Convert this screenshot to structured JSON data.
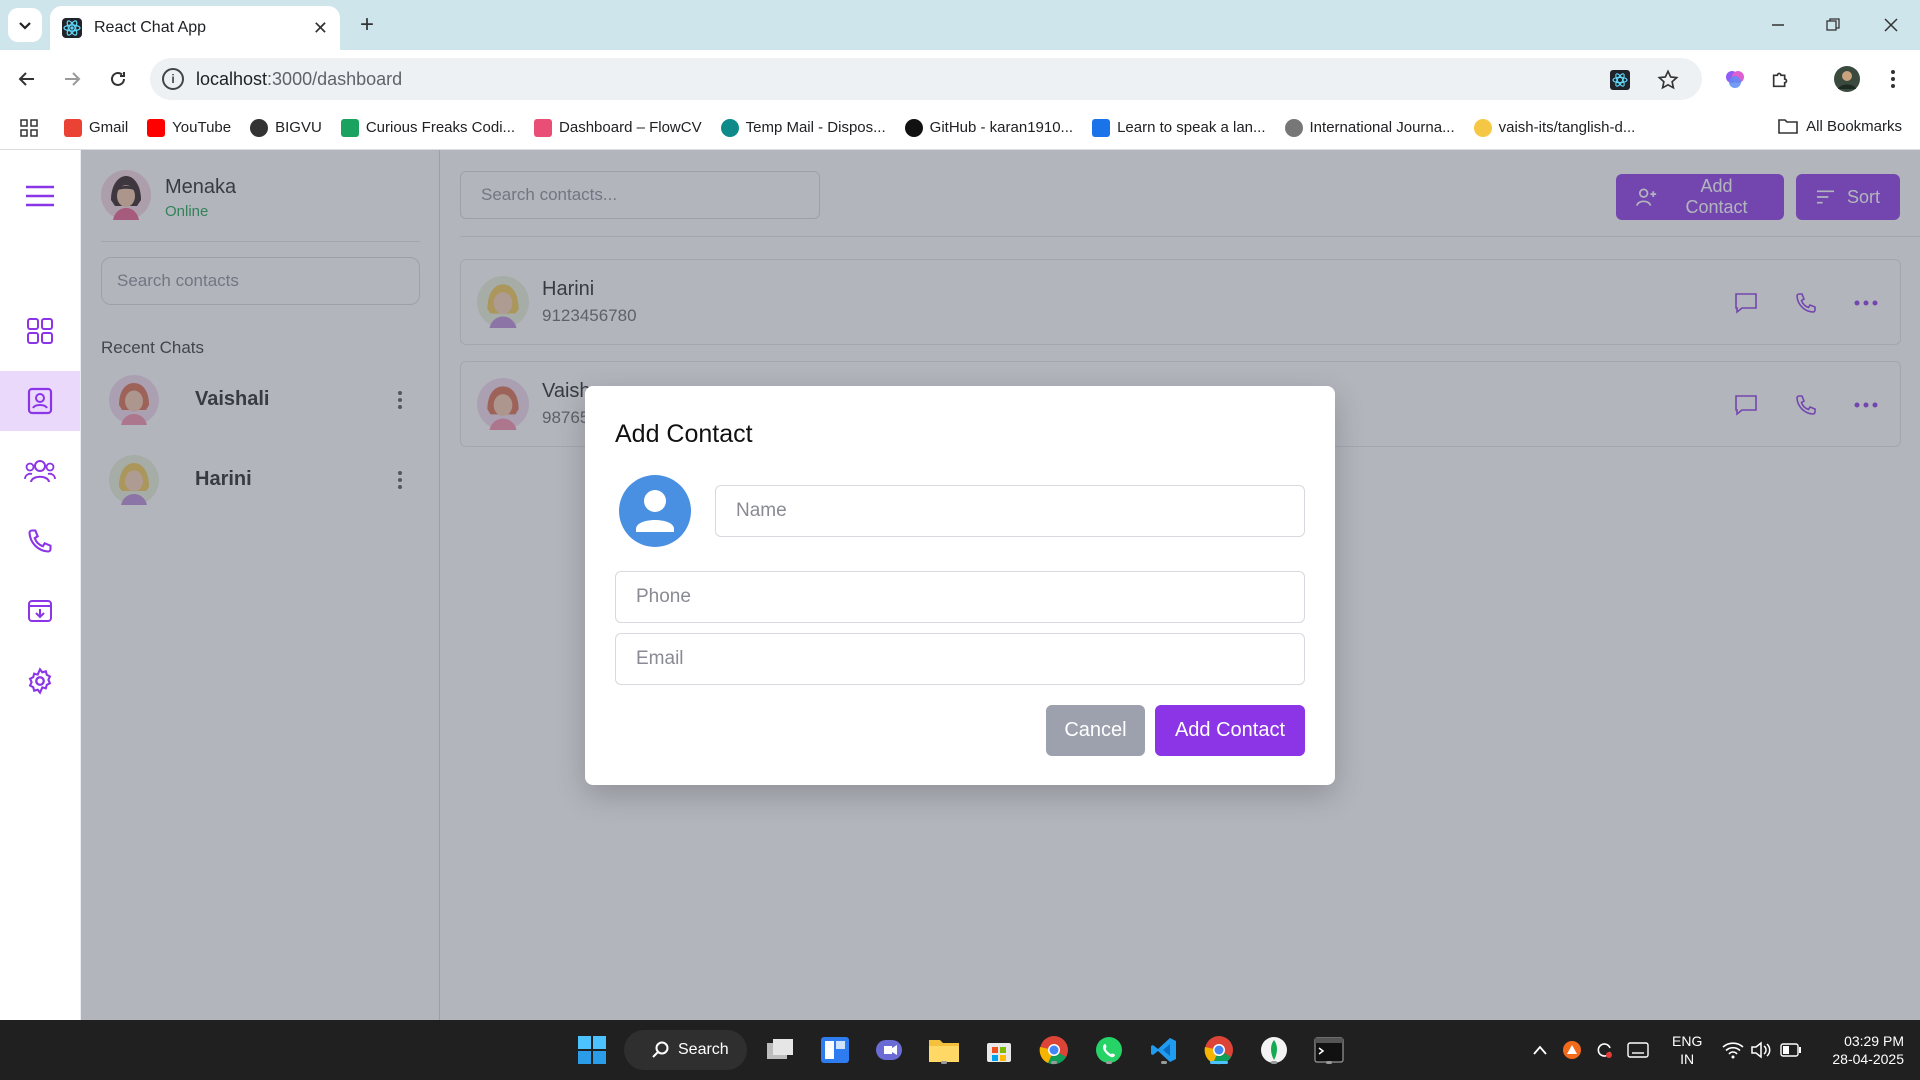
{
  "browser": {
    "tab_title": "React Chat App",
    "url_host": "localhost",
    "url_path": ":3000/dashboard"
  },
  "bookmarks": [
    {
      "label": "Gmail",
      "icon": "gmail-icon",
      "color": "#ea4335"
    },
    {
      "label": "YouTube",
      "icon": "youtube-icon",
      "color": "#ff0000"
    },
    {
      "label": "BIGVU",
      "icon": "globe-icon",
      "color": "#333333"
    },
    {
      "label": "Curious Freaks Codi...",
      "icon": "plus-icon",
      "color": "#1aa260"
    },
    {
      "label": "Dashboard – FlowCV",
      "icon": "flowcv-icon",
      "color": "#e94e77"
    },
    {
      "label": "Temp Mail - Dispos...",
      "icon": "tempmail-icon",
      "color": "#0f8a8a"
    },
    {
      "label": "GitHub - karan1910...",
      "icon": "github-icon",
      "color": "#111111"
    },
    {
      "label": "Learn to speak a lan...",
      "icon": "language-icon",
      "color": "#1a73e8"
    },
    {
      "label": "International Journa...",
      "icon": "journal-icon",
      "color": "#777777"
    },
    {
      "label": "vaish-its/tanglish-d...",
      "icon": "hugging-face-icon",
      "color": "#f6c744"
    }
  ],
  "all_bookmarks_label": "All Bookmarks",
  "user": {
    "name": "Menaka",
    "status": "Online"
  },
  "sidebar": {
    "search_placeholder": "Search contacts",
    "recent_title": "Recent Chats",
    "chats": [
      {
        "name": "Vaishali"
      },
      {
        "name": "Harini"
      }
    ]
  },
  "main": {
    "search_placeholder": "Search contacts...",
    "add_contact_label": "Add Contact",
    "sort_label": "Sort",
    "contacts": [
      {
        "name": "Harini",
        "phone": "9123456780"
      },
      {
        "name": "Vaish",
        "phone": "98765"
      }
    ]
  },
  "modal": {
    "title": "Add Contact",
    "name_placeholder": "Name",
    "phone_placeholder": "Phone",
    "email_placeholder": "Email",
    "cancel_label": "Cancel",
    "submit_label": "Add Contact"
  },
  "taskbar": {
    "search_label": "Search",
    "lang_line1": "ENG",
    "lang_line2": "IN",
    "time": "03:29 PM",
    "date": "28-04-2025"
  },
  "colors": {
    "accent": "#8b35e6",
    "online": "#16a34a",
    "rail_active_bg": "#ead9fb"
  }
}
